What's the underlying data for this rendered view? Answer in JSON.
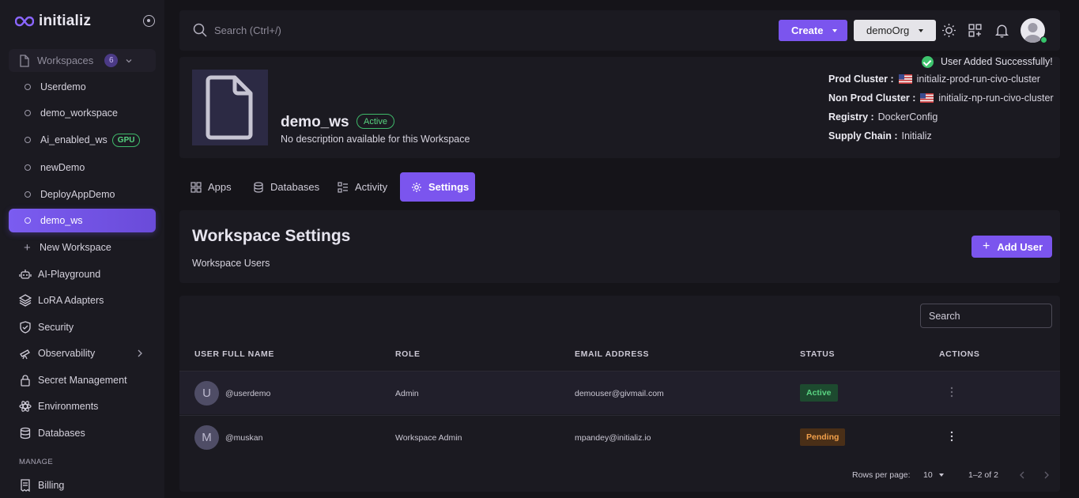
{
  "brand": {
    "name": "initializ"
  },
  "sidebar": {
    "workspaces_label": "Workspaces",
    "workspaces_count": "6",
    "workspaces": [
      {
        "label": "Userdemo",
        "badge": ""
      },
      {
        "label": "demo_workspace",
        "badge": ""
      },
      {
        "label": "Ai_enabled_ws",
        "badge": "GPU"
      },
      {
        "label": "newDemo",
        "badge": ""
      },
      {
        "label": "DeployAppDemo",
        "badge": ""
      },
      {
        "label": "demo_ws",
        "badge": "",
        "active": true
      }
    ],
    "new_workspace": "New Workspace",
    "nav": [
      {
        "label": "AI-Playground",
        "icon": "robot-icon"
      },
      {
        "label": "LoRA Adapters",
        "icon": "layers-icon"
      },
      {
        "label": "Security",
        "icon": "shield-icon"
      },
      {
        "label": "Observability",
        "icon": "telescope-icon"
      },
      {
        "label": "Secret Management",
        "icon": "lock-icon"
      },
      {
        "label": "Environments",
        "icon": "atom-icon"
      },
      {
        "label": "Databases",
        "icon": "database-icon"
      }
    ],
    "manage_label": "MANAGE",
    "billing": "Billing"
  },
  "topbar": {
    "search_placeholder": "Search (Ctrl+/)",
    "create_label": "Create",
    "org_label": "demoOrg"
  },
  "toast": {
    "message": "User Added Successfully!"
  },
  "workspace": {
    "name": "demo_ws",
    "status": "Active",
    "description": "No description available for this Workspace",
    "meta": [
      {
        "label": "Prod Cluster :",
        "value": "initializ-prod-run-civo-cluster",
        "flag": true
      },
      {
        "label": "Non Prod Cluster :",
        "value": "initializ-np-run-civo-cluster",
        "flag": true
      },
      {
        "label": "Registry :",
        "value": "DockerConfig",
        "flag": false
      },
      {
        "label": "Supply Chain :",
        "value": "Initializ",
        "flag": false
      }
    ]
  },
  "tabs": [
    {
      "label": "Apps"
    },
    {
      "label": "Databases"
    },
    {
      "label": "Activity"
    },
    {
      "label": "Settings",
      "active": true
    }
  ],
  "settings": {
    "title": "Workspace Settings",
    "subtitle": "Workspace Users",
    "add_user_label": "Add User"
  },
  "users_table": {
    "search_placeholder": "Search",
    "columns": [
      "USER FULL NAME",
      "ROLE",
      "EMAIL ADDRESS",
      "STATUS",
      "ACTIONS"
    ],
    "rows": [
      {
        "initial": "U",
        "username": "@userdemo",
        "role": "Admin",
        "email": "demouser@givmail.com",
        "status": "Active"
      },
      {
        "initial": "M",
        "username": "@muskan",
        "role": "Workspace Admin",
        "email": "mpandey@initializ.io",
        "status": "Pending"
      }
    ],
    "rows_per_page_label": "Rows per page:",
    "rows_per_page": "10",
    "range": "1–2 of 2"
  },
  "colors": {
    "accent": "#7b55ee",
    "success": "#3ec46d",
    "pending": "#f2a04b",
    "background": "#151419",
    "card": "#1b1a21"
  }
}
